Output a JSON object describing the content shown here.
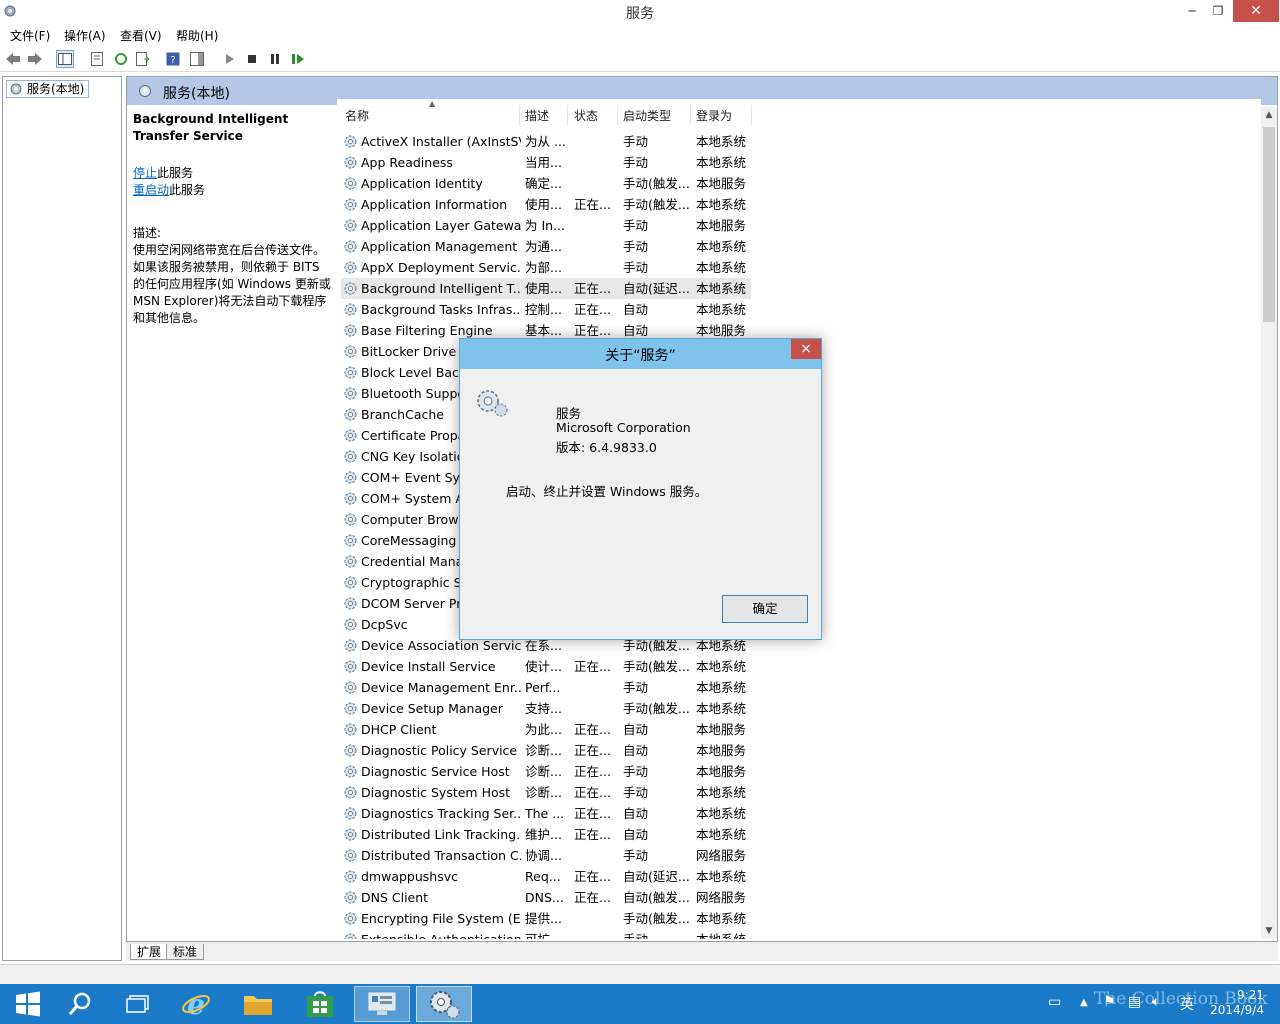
{
  "window": {
    "title": "服务"
  },
  "menu": [
    "文件(F)",
    "操作(A)",
    "查看(V)",
    "帮助(H)"
  ],
  "tree": {
    "root": "服务(本地)"
  },
  "main": {
    "header": "服务(本地)",
    "selected_service": "Background Intelligent Transfer Service",
    "action_stop_link": "停止",
    "action_stop_suffix": "此服务",
    "action_restart_link": "重启动",
    "action_restart_suffix": "此服务",
    "desc_label": "描述:",
    "description": "使用空闲网络带宽在后台传送文件。如果该服务被禁用，则依赖于 BITS 的任何应用程序(如 Windows 更新或 MSN Explorer)将无法自动下载程序和其他信息。"
  },
  "columns": [
    "名称",
    "描述",
    "状态",
    "启动类型",
    "登录为"
  ],
  "services": [
    [
      "ActiveX Installer (AxInstSV)",
      "为从 ...",
      "",
      "手动",
      "本地系统"
    ],
    [
      "App Readiness",
      "当用...",
      "",
      "手动",
      "本地系统"
    ],
    [
      "Application Identity",
      "确定...",
      "",
      "手动(触发...",
      "本地服务"
    ],
    [
      "Application Information",
      "使用...",
      "正在...",
      "手动(触发...",
      "本地系统"
    ],
    [
      "Application Layer Gatewa...",
      "为 In...",
      "",
      "手动",
      "本地服务"
    ],
    [
      "Application Management",
      "为通...",
      "",
      "手动",
      "本地系统"
    ],
    [
      "AppX Deployment Servic...",
      "为部...",
      "",
      "手动",
      "本地系统"
    ],
    [
      "Background Intelligent T...",
      "使用...",
      "正在...",
      "自动(延迟...",
      "本地系统"
    ],
    [
      "Background Tasks Infras...",
      "控制...",
      "正在...",
      "自动",
      "本地系统"
    ],
    [
      "Base Filtering Engine",
      "基本...",
      "正在...",
      "自动",
      "本地服务"
    ],
    [
      "BitLocker Drive E",
      "",
      "",
      "",
      ""
    ],
    [
      "Block Level Back",
      "",
      "",
      "",
      ""
    ],
    [
      "Bluetooth Suppo",
      "",
      "",
      "",
      ""
    ],
    [
      "BranchCache",
      "",
      "",
      "",
      ""
    ],
    [
      "Certificate Propa",
      "",
      "",
      "",
      ""
    ],
    [
      "CNG Key Isolatio",
      "",
      "",
      "",
      ""
    ],
    [
      "COM+ Event Sys",
      "",
      "",
      "",
      ""
    ],
    [
      "COM+ System A",
      "",
      "",
      "",
      ""
    ],
    [
      "Computer Brows",
      "",
      "",
      "",
      ""
    ],
    [
      "CoreMessaging",
      "",
      "",
      "",
      ""
    ],
    [
      "Credential Mana",
      "",
      "",
      "",
      ""
    ],
    [
      "Cryptographic Se",
      "",
      "",
      "",
      ""
    ],
    [
      "DCOM Server Pro",
      "",
      "",
      "",
      ""
    ],
    [
      "DcpSvc",
      "",
      "",
      "",
      ""
    ],
    [
      "Device Association Service",
      "在系...",
      "",
      "手动(触发...",
      "本地系统"
    ],
    [
      "Device Install Service",
      "使计...",
      "正在...",
      "手动(触发...",
      "本地系统"
    ],
    [
      "Device Management Enr...",
      "Perf...",
      "",
      "手动",
      "本地系统"
    ],
    [
      "Device Setup Manager",
      "支持...",
      "",
      "手动(触发...",
      "本地系统"
    ],
    [
      "DHCP Client",
      "为此...",
      "正在...",
      "自动",
      "本地服务"
    ],
    [
      "Diagnostic Policy Service",
      "诊断...",
      "正在...",
      "自动",
      "本地服务"
    ],
    [
      "Diagnostic Service Host",
      "诊断...",
      "正在...",
      "手动",
      "本地服务"
    ],
    [
      "Diagnostic System Host",
      "诊断...",
      "正在...",
      "手动",
      "本地系统"
    ],
    [
      "Diagnostics Tracking Ser...",
      "The ...",
      "正在...",
      "自动",
      "本地系统"
    ],
    [
      "Distributed Link Tracking...",
      "维护...",
      "正在...",
      "自动",
      "本地系统"
    ],
    [
      "Distributed Transaction C...",
      "协调...",
      "",
      "手动",
      "网络服务"
    ],
    [
      "dmwappushsvc",
      "Req...",
      "正在...",
      "自动(延迟...",
      "本地系统"
    ],
    [
      "DNS Client",
      "DNS...",
      "正在...",
      "自动(触发...",
      "网络服务"
    ],
    [
      "Encrypting File System (E...",
      "提供...",
      "",
      "手动(触发...",
      "本地系统"
    ],
    [
      "Extensible Authentication...",
      "可扩...",
      "",
      "手动",
      "本地系统"
    ]
  ],
  "selected_index": 7,
  "tabs": [
    "扩展",
    "标准"
  ],
  "dialog": {
    "title": "关于“服务”",
    "close": "×",
    "app_name": "服务",
    "company": "Microsoft Corporation",
    "version": "版本: 6.4.9833.0",
    "description": "启动、终止并设置 Windows 服务。",
    "ok": "确定"
  },
  "taskbar": {
    "time": "9:21",
    "date": "2014/9/4",
    "ime": "英",
    "watermark": "The Collection Book"
  },
  "colors": {
    "accent": "#1c7bc8",
    "header": "#b3c7e6",
    "dialog_title": "#7ec3ea",
    "close": "#c7504b"
  }
}
